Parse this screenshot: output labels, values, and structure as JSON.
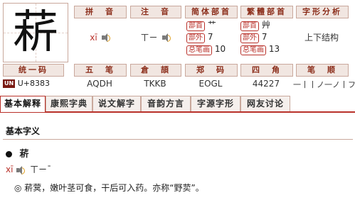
{
  "character": "菥",
  "headers_row1": [
    "拼　音",
    "注　音",
    "简体部首",
    "繁體部首",
    "字形分析"
  ],
  "pinyin": "xī",
  "zhuyin": "ㄒㄧ",
  "simplified": {
    "radical_label": "部首",
    "radical": "艹",
    "outside_label": "部外",
    "outside": "7",
    "total_label": "总笔画",
    "total": "10"
  },
  "traditional": {
    "radical_label": "部首",
    "radical": "艸",
    "outside_label": "部外",
    "outside": "7",
    "total_label": "总笔画",
    "total": "13"
  },
  "structure": "上下结构",
  "headers_row2": [
    "统一码",
    "五　笔",
    "倉　頡",
    "郑　码",
    "四　角",
    "笔　顺"
  ],
  "unicode": "U+8383",
  "unicode_icon": "UN",
  "wubi": "AQDH",
  "cangjie": "TKKB",
  "zhengma": "EOGL",
  "sijiao": "44227",
  "stroke_order": "一丨丨ノ一ノ丨フ丨",
  "tabs": [
    "基本解释",
    "康熙字典",
    "说文解字",
    "音韵方言",
    "字源字形",
    "网友讨论"
  ],
  "section_title": "基本字义",
  "entry_char": "菥",
  "entry_pinyin": "xī",
  "entry_zhuyin": "ㄒㄧˉ",
  "definition": "◎ 菥蓂，嫩叶茎可食，干后可入药。亦称“野荬”。",
  "colors": {
    "accent": "#b9312a",
    "header_bg": "#f1e6e1",
    "border": "#c9a89c"
  }
}
